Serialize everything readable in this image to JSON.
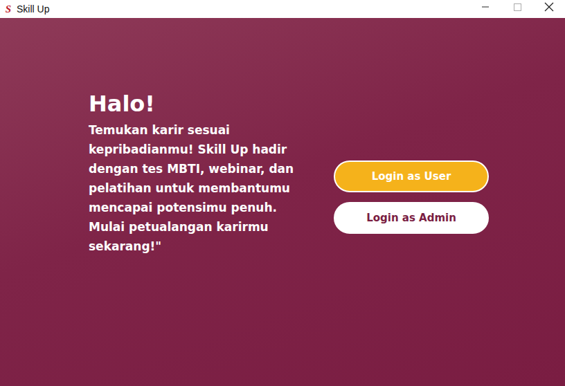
{
  "window": {
    "title": "Skill Up",
    "logo": "S"
  },
  "hero": {
    "heading": "Halo!",
    "text": "Temukan karir sesuai kepribadianmu! Skill Up hadir dengan tes MBTI, webinar, dan pelatihan untuk membantumu mencapai potensimu penuh. Mulai petualangan karirmu sekarang!\""
  },
  "buttons": [
    {
      "label": "Login as User",
      "kind": "primary"
    },
    {
      "label": "Login as Admin",
      "kind": "secondary"
    }
  ]
}
